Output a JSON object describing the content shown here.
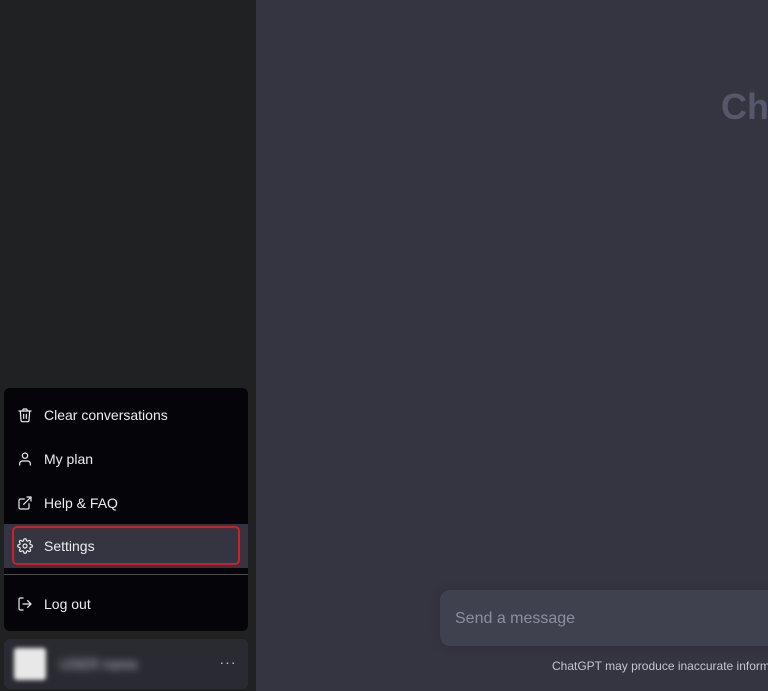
{
  "menu": {
    "items": [
      {
        "label": "Clear conversations",
        "icon": "trash-icon"
      },
      {
        "label": "My plan",
        "icon": "user-icon"
      },
      {
        "label": "Help & FAQ",
        "icon": "external-link-icon"
      },
      {
        "label": "Settings",
        "icon": "gear-icon"
      }
    ],
    "logout_label": "Log out"
  },
  "user": {
    "name": "USER name",
    "more_label": "···"
  },
  "main": {
    "hero_title": "ChatGPT",
    "composer_placeholder": "Send a message",
    "disclaimer": "ChatGPT may produce inaccurate information"
  },
  "colors": {
    "sidebar_bg": "#202123",
    "main_bg": "#343541",
    "menu_bg": "#050509",
    "highlight_border": "#d11f2a"
  }
}
